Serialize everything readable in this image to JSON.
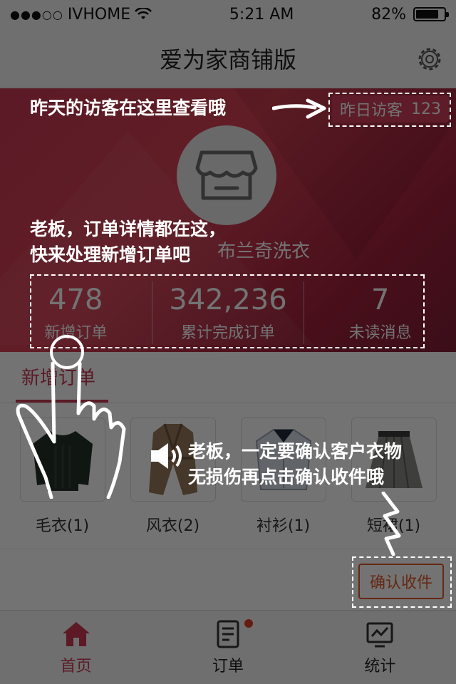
{
  "status_bar": {
    "carrier": "IVHOME",
    "time": "5:21 AM",
    "battery": "82%",
    "battery_level": 0.82
  },
  "nav": {
    "title": "爱为家商铺版",
    "settings_icon": "gear-icon"
  },
  "hero": {
    "shop_name": "布兰奇洗衣",
    "visitor_label": "昨日访客",
    "visitor_count": "123"
  },
  "stats": [
    {
      "value": "478",
      "label": "新增订单"
    },
    {
      "value": "342,236",
      "label": "累计完成订单"
    },
    {
      "value": "7",
      "label": "未读消息"
    }
  ],
  "section": {
    "tab": "新增订单",
    "categories": [
      {
        "label": "毛衣(1)",
        "icon": "sweater-icon"
      },
      {
        "label": "风衣(2)",
        "icon": "trench-coat-icon"
      },
      {
        "label": "衬衫(1)",
        "icon": "shirt-icon"
      },
      {
        "label": "短裙(1)",
        "icon": "skirt-icon"
      }
    ]
  },
  "confirm_button": "确认收件",
  "tabbar": [
    {
      "label": "首页",
      "icon": "home-icon",
      "active": true
    },
    {
      "label": "订单",
      "icon": "order-icon",
      "badge": true
    },
    {
      "label": "统计",
      "icon": "chart-icon"
    }
  ],
  "guide": {
    "visitor_hint": "昨天的访客在这里查看哦",
    "orders_hint_line1": "老板，订单详情都在这，",
    "orders_hint_line2": "快来处理新增订单吧",
    "confirm_hint_line1": "老板，一定要确认客户衣物",
    "confirm_hint_line2": "无损伤再点击确认收件哦"
  },
  "colors": {
    "accent": "#c93a53",
    "confirm": "#e05a2c",
    "overlay": "rgba(0,0,0,0.55)"
  }
}
